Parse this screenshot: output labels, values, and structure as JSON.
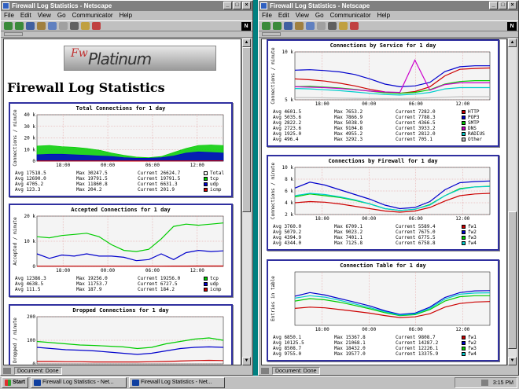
{
  "windows": [
    {
      "id": "left",
      "title": "Firewall Log Statistics - Netscape",
      "status": "Document: Done",
      "menu": [
        "File",
        "Edit",
        "View",
        "Go",
        "Communicator",
        "Help"
      ],
      "logo": {
        "fw": "Fw",
        "platinum": "Platinum"
      },
      "page_title": "Firewall Log Statistics",
      "panels": [
        {
          "title": "Total Connections for 1 day",
          "ylabel": "Connections / minute",
          "rows": [
            {
              "avg": "Avg 17518.5",
              "max": "Max 30247.5",
              "cur": "Current 26624.7",
              "label": "Total",
              "color": "#ffffff"
            },
            {
              "avg": "Avg 12690.0",
              "max": "Max 19791.5",
              "cur": "Current 19791.5",
              "label": "tcp",
              "color": "#00cc00"
            },
            {
              "avg": "Avg 4705.2",
              "max": "Max 11860.8",
              "cur": "Current 6631.3",
              "label": "udp",
              "color": "#0000cc"
            },
            {
              "avg": "Avg 123.3",
              "max": "Max 204.2",
              "cur": "Current 201.9",
              "label": "icmp",
              "color": "#cc0000"
            }
          ]
        },
        {
          "title": "Accepted Connections for 1 day",
          "ylabel": "Accepted / minute",
          "rows": [
            {
              "avg": "Avg 12386.3",
              "max": "Max 19256.0",
              "cur": "Current 19256.0",
              "label": "tcp",
              "color": "#00cc00"
            },
            {
              "avg": "Avg 4638.5",
              "max": "Max 11753.7",
              "cur": "Current 6727.5",
              "label": "udp",
              "color": "#0000cc"
            },
            {
              "avg": "Avg 111.5",
              "max": "Max 187.9",
              "cur": "Current 184.2",
              "label": "icmp",
              "color": "#cc0000"
            }
          ]
        },
        {
          "title": "Dropped Connections for 1 day",
          "ylabel": "Dropped / minute",
          "rows": []
        }
      ]
    },
    {
      "id": "right",
      "title": "Firewall Log Statistics - Netscape",
      "status": "Document: Done",
      "menu": [
        "File",
        "Edit",
        "View",
        "Go",
        "Communicator",
        "Help"
      ],
      "panels": [
        {
          "title": "Connections by Service for 1 day",
          "ylabel": "Connections / minute",
          "rows": [
            {
              "avg": "Avg 4601.5",
              "max": "Max 7653.2",
              "cur": "Current 7282.0",
              "label": "HTTP",
              "color": "#cc0000"
            },
            {
              "avg": "Avg 5035.6",
              "max": "Max 7866.9",
              "cur": "Current 7788.3",
              "label": "POP3",
              "color": "#0000cc"
            },
            {
              "avg": "Avg 2822.2",
              "max": "Max 5038.9",
              "cur": "Current 4366.5",
              "label": "SMTP",
              "color": "#00cc00"
            },
            {
              "avg": "Avg 2723.6",
              "max": "Max 9104.8",
              "cur": "Current 3933.2",
              "label": "DNS",
              "color": "#cc00cc"
            },
            {
              "avg": "Avg 1925.0",
              "max": "Max 4955.2",
              "cur": "Current 2812.0",
              "label": "RADIUS",
              "color": "#00cccc"
            },
            {
              "avg": "Avg 496.4",
              "max": "Max 3292.3",
              "cur": "Current 705.1",
              "label": "Other",
              "color": "#c0c0c0"
            }
          ]
        },
        {
          "title": "Connections by Firewall for 1 day",
          "ylabel": "Connections / minute",
          "rows": [
            {
              "avg": "Avg 3760.0",
              "max": "Max 6709.1",
              "cur": "Current 5589.4",
              "label": "fw1",
              "color": "#cc0000"
            },
            {
              "avg": "Avg 5079.2",
              "max": "Max 9023.2",
              "cur": "Current 7675.0",
              "label": "fw2",
              "color": "#0000cc"
            },
            {
              "avg": "Avg 4394.9",
              "max": "Max 7401.1",
              "cur": "Current 6775.5",
              "label": "fw3",
              "color": "#00cc00"
            },
            {
              "avg": "Avg 4344.0",
              "max": "Max 7125.8",
              "cur": "Current 6758.8",
              "label": "fw4",
              "color": "#00cccc"
            }
          ]
        },
        {
          "title": "Connection Table for 1 day",
          "ylabel": "Entries in table",
          "rows": [
            {
              "avg": "Avg 6850.1",
              "max": "Max 15367.8",
              "cur": "Current 9808.7",
              "label": "fw1",
              "color": "#cc0000"
            },
            {
              "avg": "Avg 10125.5",
              "max": "Max 21068.1",
              "cur": "Current 14287.2",
              "label": "fw2",
              "color": "#0000cc"
            },
            {
              "avg": "Avg 8508.7",
              "max": "Max 18432.0",
              "cur": "Current 12226.1",
              "label": "fw3",
              "color": "#00cc00"
            },
            {
              "avg": "Avg 9755.0",
              "max": "Max 19577.0",
              "cur": "Current 13375.9",
              "label": "fw4",
              "color": "#00cccc"
            }
          ]
        }
      ]
    }
  ],
  "chart_data": [
    {
      "type": "area",
      "title": "Total Connections for 1 day",
      "ylabel": "Connections / minute",
      "x": [
        "18:00",
        "00:00",
        "06:00",
        "12:00"
      ],
      "yticks": [
        "0",
        "10 k",
        "20 k",
        "30 k",
        "40 k"
      ],
      "ylim": [
        0,
        40000
      ],
      "series": [
        {
          "name": "tcp",
          "color": "#00cc00",
          "values": [
            13000,
            13500,
            12500,
            12000,
            11000,
            9500,
            7000,
            5000,
            3500,
            3000,
            4000,
            7500,
            11000,
            13500,
            14000,
            13500
          ]
        },
        {
          "name": "udp",
          "color": "#0000cc",
          "values": [
            5500,
            6000,
            6000,
            5500,
            5000,
            4500,
            4000,
            3000,
            2500,
            2500,
            3000,
            4500,
            7000,
            8000,
            7500,
            7000
          ]
        },
        {
          "name": "icmp",
          "color": "#cc0000",
          "values": [
            120,
            130,
            120,
            120,
            110,
            110,
            100,
            100,
            100,
            100,
            110,
            130,
            150,
            160,
            190,
            200
          ]
        }
      ]
    },
    {
      "type": "line",
      "title": "Accepted Connections for 1 day",
      "ylabel": "Accepted / minute",
      "x": [
        "18:00",
        "00:00",
        "06:00",
        "12:00"
      ],
      "yticks": [
        "0",
        "10 k",
        "20 k"
      ],
      "ylim": [
        0,
        22000
      ],
      "series": [
        {
          "name": "tcp",
          "color": "#00cc00",
          "values": [
            13000,
            12500,
            13500,
            14000,
            14500,
            13000,
            9500,
            7000,
            6500,
            7500,
            12000,
            17500,
            18500,
            18000,
            18500,
            19000
          ]
        },
        {
          "name": "udp",
          "color": "#0000cc",
          "values": [
            5500,
            3500,
            5000,
            4500,
            5500,
            4500,
            4500,
            4000,
            2500,
            3000,
            5500,
            3000,
            6000,
            7000,
            6500,
            6800
          ]
        },
        {
          "name": "icmp",
          "color": "#cc0000",
          "values": [
            120,
            110,
            110,
            110,
            110,
            100,
            100,
            100,
            100,
            100,
            110,
            130,
            150,
            160,
            180,
            184
          ]
        }
      ]
    },
    {
      "type": "line",
      "title": "Dropped Connections for 1 day",
      "ylabel": "Dropped / minute",
      "x": [],
      "yticks": [
        "0",
        "100",
        "200"
      ],
      "ylim": [
        0,
        200
      ],
      "series": [
        {
          "name": "tcp",
          "color": "#00cc00",
          "values": [
            95,
            90,
            85,
            80,
            78,
            75,
            72,
            65,
            70,
            85,
            95,
            105,
            110,
            100
          ]
        },
        {
          "name": "udp",
          "color": "#0000cc",
          "values": [
            70,
            65,
            60,
            58,
            55,
            50,
            45,
            40,
            45,
            55,
            65,
            70,
            72,
            70
          ]
        },
        {
          "name": "icmp",
          "color": "#cc0000",
          "values": [
            10,
            10,
            9,
            9,
            8,
            8,
            8,
            8,
            9,
            10,
            12,
            14,
            15,
            14
          ]
        }
      ]
    },
    {
      "type": "line",
      "title": "Connections by Service for 1 day",
      "ylabel": "Connections / minute",
      "x": [
        "18:00",
        "00:00",
        "06:00",
        "12:00"
      ],
      "yticks": [
        "5 k",
        "10 k"
      ],
      "ylim": [
        0,
        11000
      ],
      "series": [
        {
          "name": "HTTP",
          "color": "#cc0000",
          "values": [
            4800,
            4600,
            4300,
            3800,
            3200,
            2400,
            1800,
            1500,
            1900,
            3000,
            5500,
            7000,
            7200,
            7300
          ]
        },
        {
          "name": "POP3",
          "color": "#0000cc",
          "values": [
            6800,
            6900,
            6700,
            6400,
            5800,
            4800,
            3600,
            3000,
            3200,
            4000,
            6500,
            7600,
            7800,
            7800
          ]
        },
        {
          "name": "SMTP",
          "color": "#00cc00",
          "values": [
            3000,
            3100,
            2900,
            2700,
            2400,
            2000,
            1600,
            1500,
            1700,
            2300,
            3600,
            4200,
            4400,
            4400
          ]
        },
        {
          "name": "DNS",
          "color": "#cc00cc",
          "values": [
            3000,
            2900,
            2800,
            2600,
            2300,
            2000,
            1800,
            1700,
            9100,
            2200,
            3500,
            3900,
            3900,
            3900
          ]
        },
        {
          "name": "RADIUS",
          "color": "#00cccc",
          "values": [
            2600,
            2500,
            2300,
            2100,
            1800,
            1500,
            1200,
            1100,
            1300,
            1700,
            2500,
            2800,
            2800,
            2800
          ]
        },
        {
          "name": "Other",
          "color": "#c0c0c0",
          "values": [
            500,
            500,
            450,
            400,
            350,
            300,
            300,
            300,
            350,
            450,
            600,
            700,
            700,
            705
          ]
        }
      ]
    },
    {
      "type": "line",
      "title": "Connections by Firewall for 1 day",
      "ylabel": "Connections / minute",
      "x": [
        "18:00",
        "00:00",
        "06:00",
        "12:00"
      ],
      "yticks": [
        "2 k",
        "4 k",
        "6 k",
        "8 k",
        "10 k"
      ],
      "ylim": [
        2000,
        10000
      ],
      "series": [
        {
          "name": "fw1",
          "color": "#cc0000",
          "values": [
            4000,
            4200,
            4100,
            3800,
            3400,
            3000,
            2600,
            2400,
            2600,
            3200,
            4300,
            5200,
            5500,
            5600
          ]
        },
        {
          "name": "fw2",
          "color": "#0000cc",
          "values": [
            6500,
            7500,
            7000,
            6200,
            5400,
            4600,
            3600,
            3000,
            3200,
            4200,
            6200,
            7400,
            7600,
            7700
          ]
        },
        {
          "name": "fw3",
          "color": "#00cc00",
          "values": [
            5000,
            5500,
            5200,
            4900,
            4400,
            3800,
            3000,
            2700,
            2900,
            3700,
            5200,
            6400,
            6700,
            6800
          ]
        },
        {
          "name": "fw4",
          "color": "#00cccc",
          "values": [
            5200,
            5600,
            5400,
            5000,
            4500,
            3800,
            3000,
            2700,
            2900,
            3600,
            5200,
            6300,
            6700,
            6760
          ]
        }
      ]
    },
    {
      "type": "line",
      "title": "Connection Table for 1 day",
      "ylabel": "Entries in table",
      "x": [
        "18:00",
        "00:00",
        "06:00",
        "12:00"
      ],
      "yticks": [],
      "ylim": [
        0,
        22000
      ],
      "series": [
        {
          "name": "fw1",
          "color": "#cc0000",
          "values": [
            7000,
            7500,
            7200,
            6500,
            5800,
            5000,
            4000,
            3200,
            3500,
            4800,
            7500,
            9000,
            9600,
            9800
          ]
        },
        {
          "name": "fw2",
          "color": "#0000cc",
          "values": [
            12000,
            13500,
            12500,
            11000,
            9500,
            8000,
            6000,
            4500,
            5000,
            7500,
            11500,
            13500,
            14200,
            14300
          ]
        },
        {
          "name": "fw3",
          "color": "#00cc00",
          "values": [
            10000,
            11000,
            10500,
            9500,
            8200,
            6800,
            5200,
            4000,
            4400,
            6500,
            10000,
            11800,
            12200,
            12200
          ]
        },
        {
          "name": "fw4",
          "color": "#00cccc",
          "values": [
            11200,
            12200,
            11600,
            10300,
            8800,
            7300,
            5600,
            4200,
            4700,
            7000,
            10800,
            12800,
            13300,
            13400
          ]
        }
      ]
    }
  ],
  "taskbar": {
    "start": "Start",
    "buttons": [
      "Firewall Log Statistics - Net...",
      "Firewall Log Statistics - Net..."
    ],
    "clock": "3:15 PM"
  }
}
